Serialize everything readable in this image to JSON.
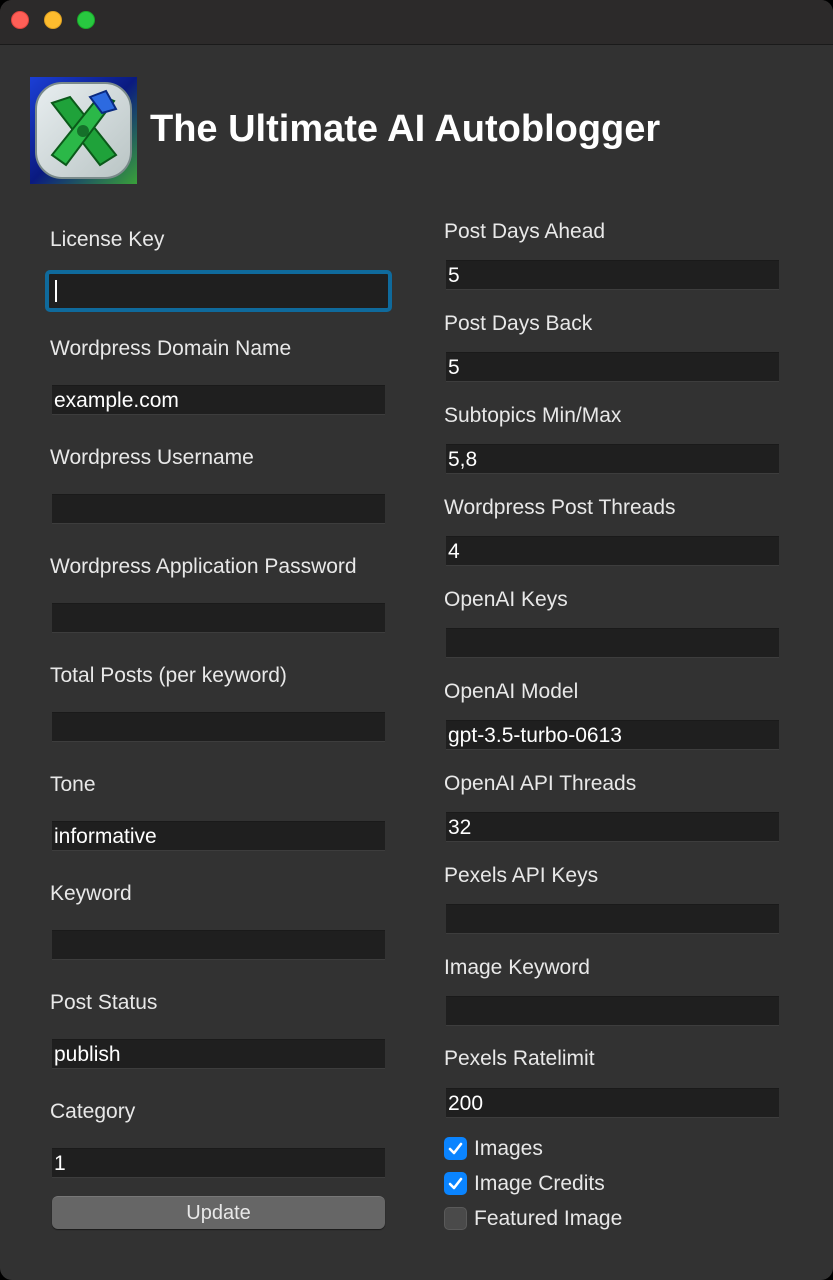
{
  "window": {
    "title": "The Ultimate AI Autoblogger"
  },
  "left": {
    "license_key": {
      "label": "License Key",
      "value": ""
    },
    "domain": {
      "label": "Wordpress Domain Name",
      "value": "example.com"
    },
    "username": {
      "label": "Wordpress Username",
      "value": ""
    },
    "app_password": {
      "label": "Wordpress Application Password",
      "value": ""
    },
    "total_posts": {
      "label": "Total Posts (per keyword)",
      "value": ""
    },
    "tone": {
      "label": "Tone",
      "value": "informative"
    },
    "keyword": {
      "label": "Keyword",
      "value": ""
    },
    "post_status": {
      "label": "Post Status",
      "value": "publish"
    },
    "category": {
      "label": "Category",
      "value": "1"
    },
    "update_label": "Update"
  },
  "right": {
    "days_ahead": {
      "label": "Post Days Ahead",
      "value": "5"
    },
    "days_back": {
      "label": "Post Days Back",
      "value": "5"
    },
    "subtopics": {
      "label": "Subtopics Min/Max",
      "value": "5,8"
    },
    "post_threads": {
      "label": "Wordpress Post Threads",
      "value": "4"
    },
    "openai_keys": {
      "label": "OpenAI Keys",
      "value": ""
    },
    "openai_model": {
      "label": "OpenAI Model",
      "value": "gpt-3.5-turbo-0613"
    },
    "api_threads": {
      "label": "OpenAI API Threads",
      "value": "32"
    },
    "pexels_keys": {
      "label": "Pexels API Keys",
      "value": ""
    },
    "image_keyword": {
      "label": "Image Keyword",
      "value": ""
    },
    "pexels_ratelimit": {
      "label": "Pexels Ratelimit",
      "value": "200"
    },
    "checkboxes": [
      {
        "label": "Images",
        "checked": true
      },
      {
        "label": "Image Credits",
        "checked": true
      },
      {
        "label": "Featured Image",
        "checked": false
      }
    ]
  },
  "colors": {
    "accent": "#0a84ff",
    "focus_ring": "#0f6a9c",
    "background": "#323232"
  }
}
